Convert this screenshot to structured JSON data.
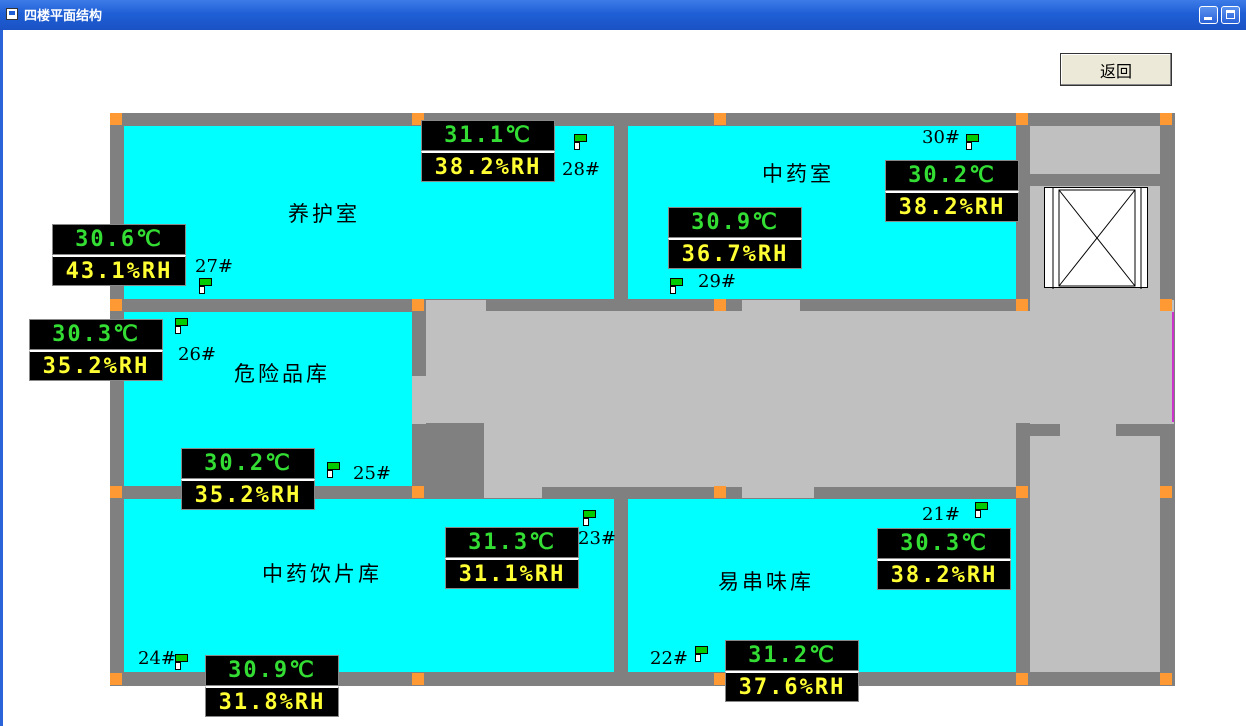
{
  "window": {
    "title": "四楼平面结构"
  },
  "buttons": {
    "back_label": "返回"
  },
  "rooms": {
    "yanghu": "养护室",
    "zhongyao": "中药室",
    "weixianpin": "危险品库",
    "yinpian": "中药饮片库",
    "yichuanwei": "易串味库"
  },
  "sensors": {
    "s21": {
      "id": "21#",
      "temp": "30.3℃",
      "hum": "38.2%RH"
    },
    "s22": {
      "id": "22#",
      "temp": "31.2℃",
      "hum": "37.6%RH"
    },
    "s23": {
      "id": "23#",
      "temp": "31.3℃",
      "hum": "31.1%RH"
    },
    "s24": {
      "id": "24#",
      "temp": "30.9℃",
      "hum": "31.8%RH"
    },
    "s25": {
      "id": "25#",
      "temp": "30.2℃",
      "hum": "35.2%RH"
    },
    "s26": {
      "id": "26#",
      "temp": "30.3℃",
      "hum": "35.2%RH"
    },
    "s27": {
      "id": "27#",
      "temp": "30.6℃",
      "hum": "43.1%RH"
    },
    "s28": {
      "id": "28#",
      "temp": "31.1℃",
      "hum": "38.2%RH"
    },
    "s29": {
      "id": "29#",
      "temp": "30.9℃",
      "hum": "36.7%RH"
    },
    "s30": {
      "id": "30#",
      "temp": "30.2℃",
      "hum": "38.2%RH"
    }
  },
  "colors": {
    "room_fill": "#00ffff",
    "wall": "#808080",
    "corridor": "#c0c0c0",
    "pillar": "#ff9933",
    "temp_text": "#33dd33",
    "hum_text": "#ffff33",
    "flag": "#00cc00"
  }
}
